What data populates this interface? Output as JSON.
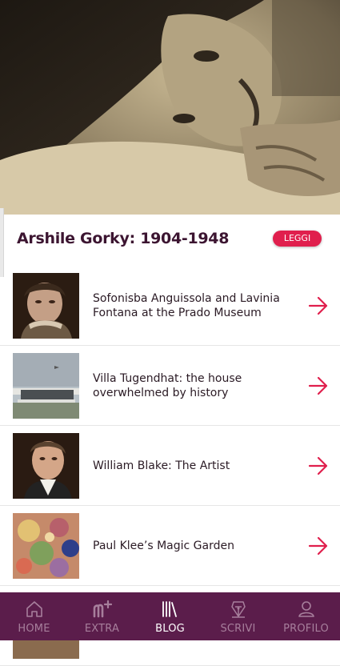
{
  "feature": {
    "title": "Arshile Gorky: 1904-1948",
    "read_label": "LEGGI",
    "accent": "#e01f4d",
    "title_color": "#3c1531"
  },
  "articles": [
    {
      "title": "Sofonisba Anguissola and Lavinia Fontana at the Prado Museum",
      "thumb": "portrait-painting"
    },
    {
      "title": "Villa Tugendhat: the house overwhelmed by history",
      "thumb": "modernist-house-photo"
    },
    {
      "title": "William Blake: The Artist",
      "thumb": "blake-portrait"
    },
    {
      "title": "Paul Klee’s Magic Garden",
      "thumb": "abstract-painting"
    }
  ],
  "nav": {
    "color": "#5b1d4b",
    "items": [
      {
        "label": "HOME",
        "icon": "home-icon"
      },
      {
        "label": "EXTRA",
        "icon": "extra-icon"
      },
      {
        "label": "BLOG",
        "icon": "books-icon",
        "active": true
      },
      {
        "label": "SCRIVI",
        "icon": "pen-icon"
      },
      {
        "label": "PROFILO",
        "icon": "user-icon"
      }
    ]
  }
}
